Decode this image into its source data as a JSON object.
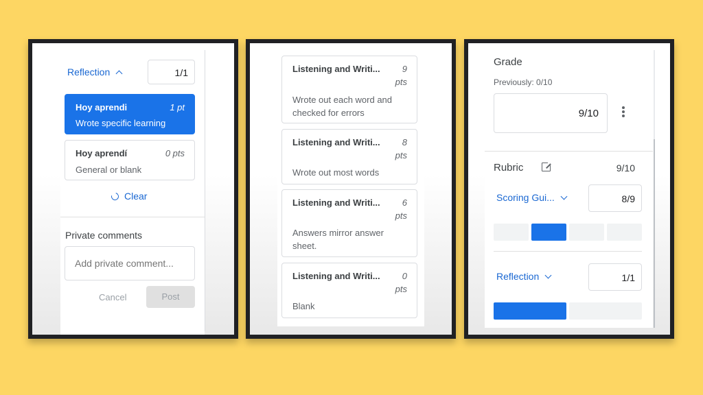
{
  "panel1": {
    "criterion": {
      "label": "Reflection",
      "score": "1/1",
      "expanded": true
    },
    "levels": [
      {
        "title": "Hoy aprendi",
        "points": "1 pt",
        "description": "Wrote specific learning",
        "selected": true
      },
      {
        "title": "Hoy aprendí",
        "points": "0 pts",
        "description": "General or blank",
        "selected": false
      }
    ],
    "clear_label": "Clear",
    "private_comments": {
      "heading": "Private comments",
      "placeholder": "Add private comment...",
      "cancel_label": "Cancel",
      "post_label": "Post"
    }
  },
  "panel2": {
    "levels": [
      {
        "title": "Listening and Writi...",
        "points_num": "9",
        "points_unit": "pts",
        "description": "Wrote out each word and checked for errors"
      },
      {
        "title": "Listening and Writi...",
        "points_num": "8",
        "points_unit": "pts",
        "description": "Wrote out most words"
      },
      {
        "title": "Listening and Writi...",
        "points_num": "6",
        "points_unit": "pts",
        "description": "Answers mirror answer sheet."
      },
      {
        "title": "Listening and Writi...",
        "points_num": "0",
        "points_unit": "pts",
        "description": "Blank"
      }
    ]
  },
  "panel3": {
    "grade": {
      "heading": "Grade",
      "previously": "Previously: 0/10",
      "value": "9/10"
    },
    "rubric": {
      "heading": "Rubric",
      "total": "9/10"
    },
    "criteria": [
      {
        "label": "Scoring Gui...",
        "score": "8/9",
        "levels": 4,
        "selected_index": 1
      },
      {
        "label": "Reflection",
        "score": "1/1",
        "levels": 2,
        "selected_index": 0
      }
    ]
  },
  "colors": {
    "background": "#fdd663",
    "accent": "#1a73e8",
    "frame": "#202124"
  }
}
